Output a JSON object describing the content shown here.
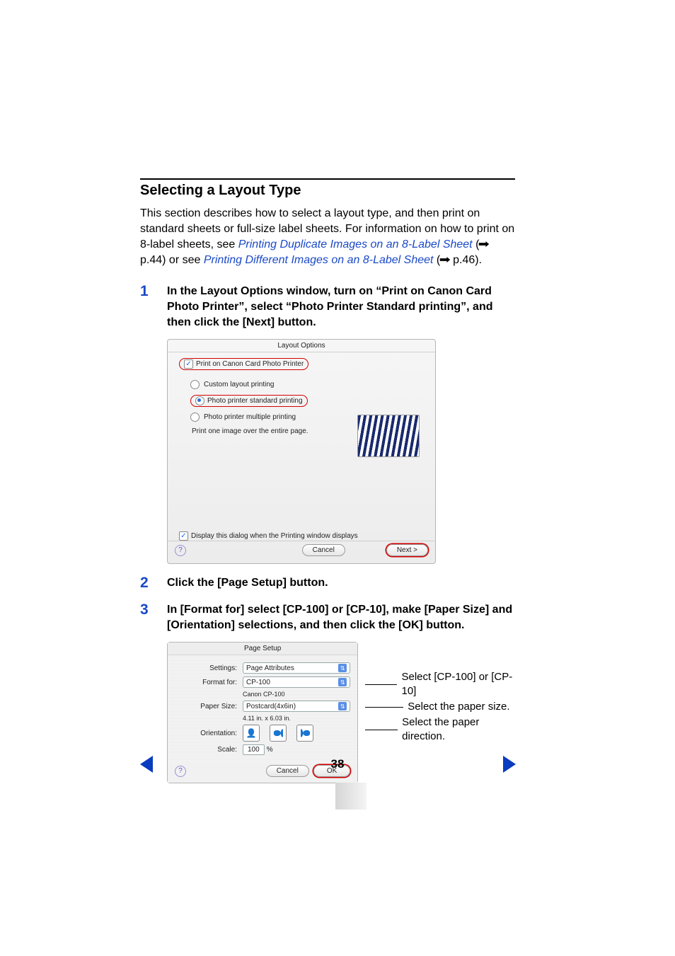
{
  "heading": "Selecting a Layout Type",
  "intro": {
    "p1a": "This section describes how to select a layout type, and then print on standard sheets or full-size label sheets. For information on how to print on 8-label sheets, see ",
    "link1": "Printing Duplicate Images on an 8-Label Sheet",
    "p1b": " (",
    "arrow1": "➡",
    "ref1": " p.44) or see ",
    "link2": "Printing Different Images on an 8-Label Sheet",
    "p1c": " (",
    "arrow2": "➡",
    "ref2": " p.46)."
  },
  "steps": {
    "s1": {
      "num": "1",
      "text": "In the Layout Options window, turn on “Print on Canon Card Photo Printer”, select “Photo Printer Standard printing”, and then click the [Next] button."
    },
    "s2": {
      "num": "2",
      "text": "Click the [Page Setup] button."
    },
    "s3": {
      "num": "3",
      "text": "In [Format for] select [CP-100] or [CP-10], make [Paper Size] and [Orientation] selections, and then click the [OK] button."
    }
  },
  "fig1": {
    "title": "Layout Options",
    "print_on": "Print on Canon Card Photo Printer",
    "r1": "Custom layout printing",
    "r2": "Photo printer standard printing",
    "r3": "Photo printer multiple printing",
    "hint": "Print one image over the entire page.",
    "display_dialog": "Display this dialog when the Printing window displays",
    "cancel": "Cancel",
    "next": "Next >"
  },
  "fig2": {
    "title": "Page Setup",
    "settings_lbl": "Settings:",
    "settings_val": "Page Attributes",
    "format_lbl": "Format for:",
    "format_val": "CP-100",
    "format_sub": "Canon CP-100",
    "paper_lbl": "Paper Size:",
    "paper_val": "Postcard(4x6in)",
    "paper_sub": "4.11 in. x 6.03 in.",
    "orient_lbl": "Orientation:",
    "scale_lbl": "Scale:",
    "scale_val": "100",
    "scale_unit": "%",
    "cancel": "Cancel",
    "ok": "OK"
  },
  "annotations": {
    "a1": "Select [CP-100] or [CP-10]",
    "a2": "Select the paper size.",
    "a3": "Select the paper direction."
  },
  "page_number": "38"
}
